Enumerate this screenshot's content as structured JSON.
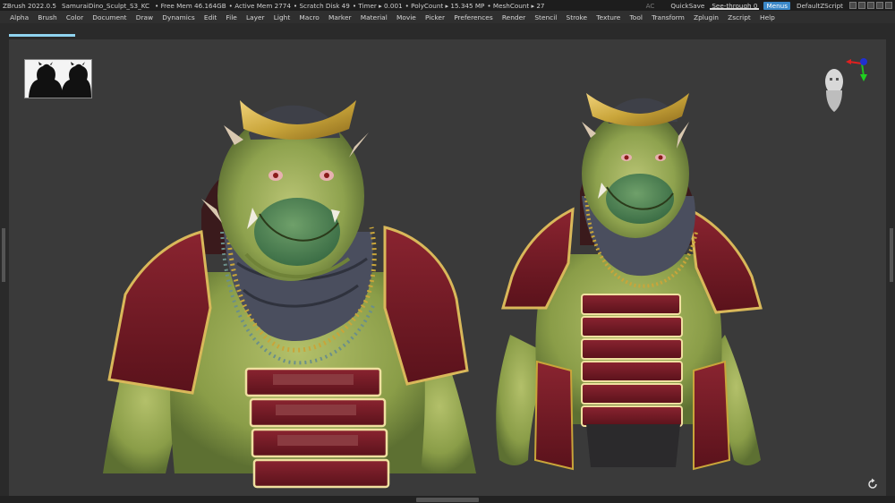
{
  "titlebar": {
    "app": "ZBrush 2022.0.5",
    "file": "SamuraiDino_Sculpt_S3_KC",
    "free_mem": "• Free Mem 46.164GB",
    "active_mem": "• Active Mem 2774",
    "scratch_disk": "• Scratch Disk 49",
    "timer": "• Timer ▸ 0.001",
    "polycount": "• PolyCount ▸ 15.345 MP",
    "meshcount": "• MeshCount ▸ 27",
    "ac": "AC",
    "quicksave": "QuickSave",
    "see_through": "See-through  0",
    "menus": "Menus",
    "default_zscript": "DefaultZScript"
  },
  "menubar": {
    "items": [
      "Alpha",
      "Brush",
      "Color",
      "Document",
      "Draw",
      "Dynamics",
      "Edit",
      "File",
      "Layer",
      "Light",
      "Macro",
      "Marker",
      "Material",
      "Movie",
      "Picker",
      "Preferences",
      "Render",
      "Stencil",
      "Stroke",
      "Texture",
      "Tool",
      "Transform",
      "Zplugin",
      "Zscript",
      "Help"
    ]
  },
  "colors": {
    "accent": "#3b88c8",
    "tab_active": "#8fd3ef",
    "skin": "#8ea24e",
    "armor_red": "#6e1822",
    "gold": "#c9a53a",
    "collar": "#4a4e5e"
  },
  "icons": {
    "rotate": "rotate-icon",
    "gizmo": "axis-gizmo-icon"
  }
}
